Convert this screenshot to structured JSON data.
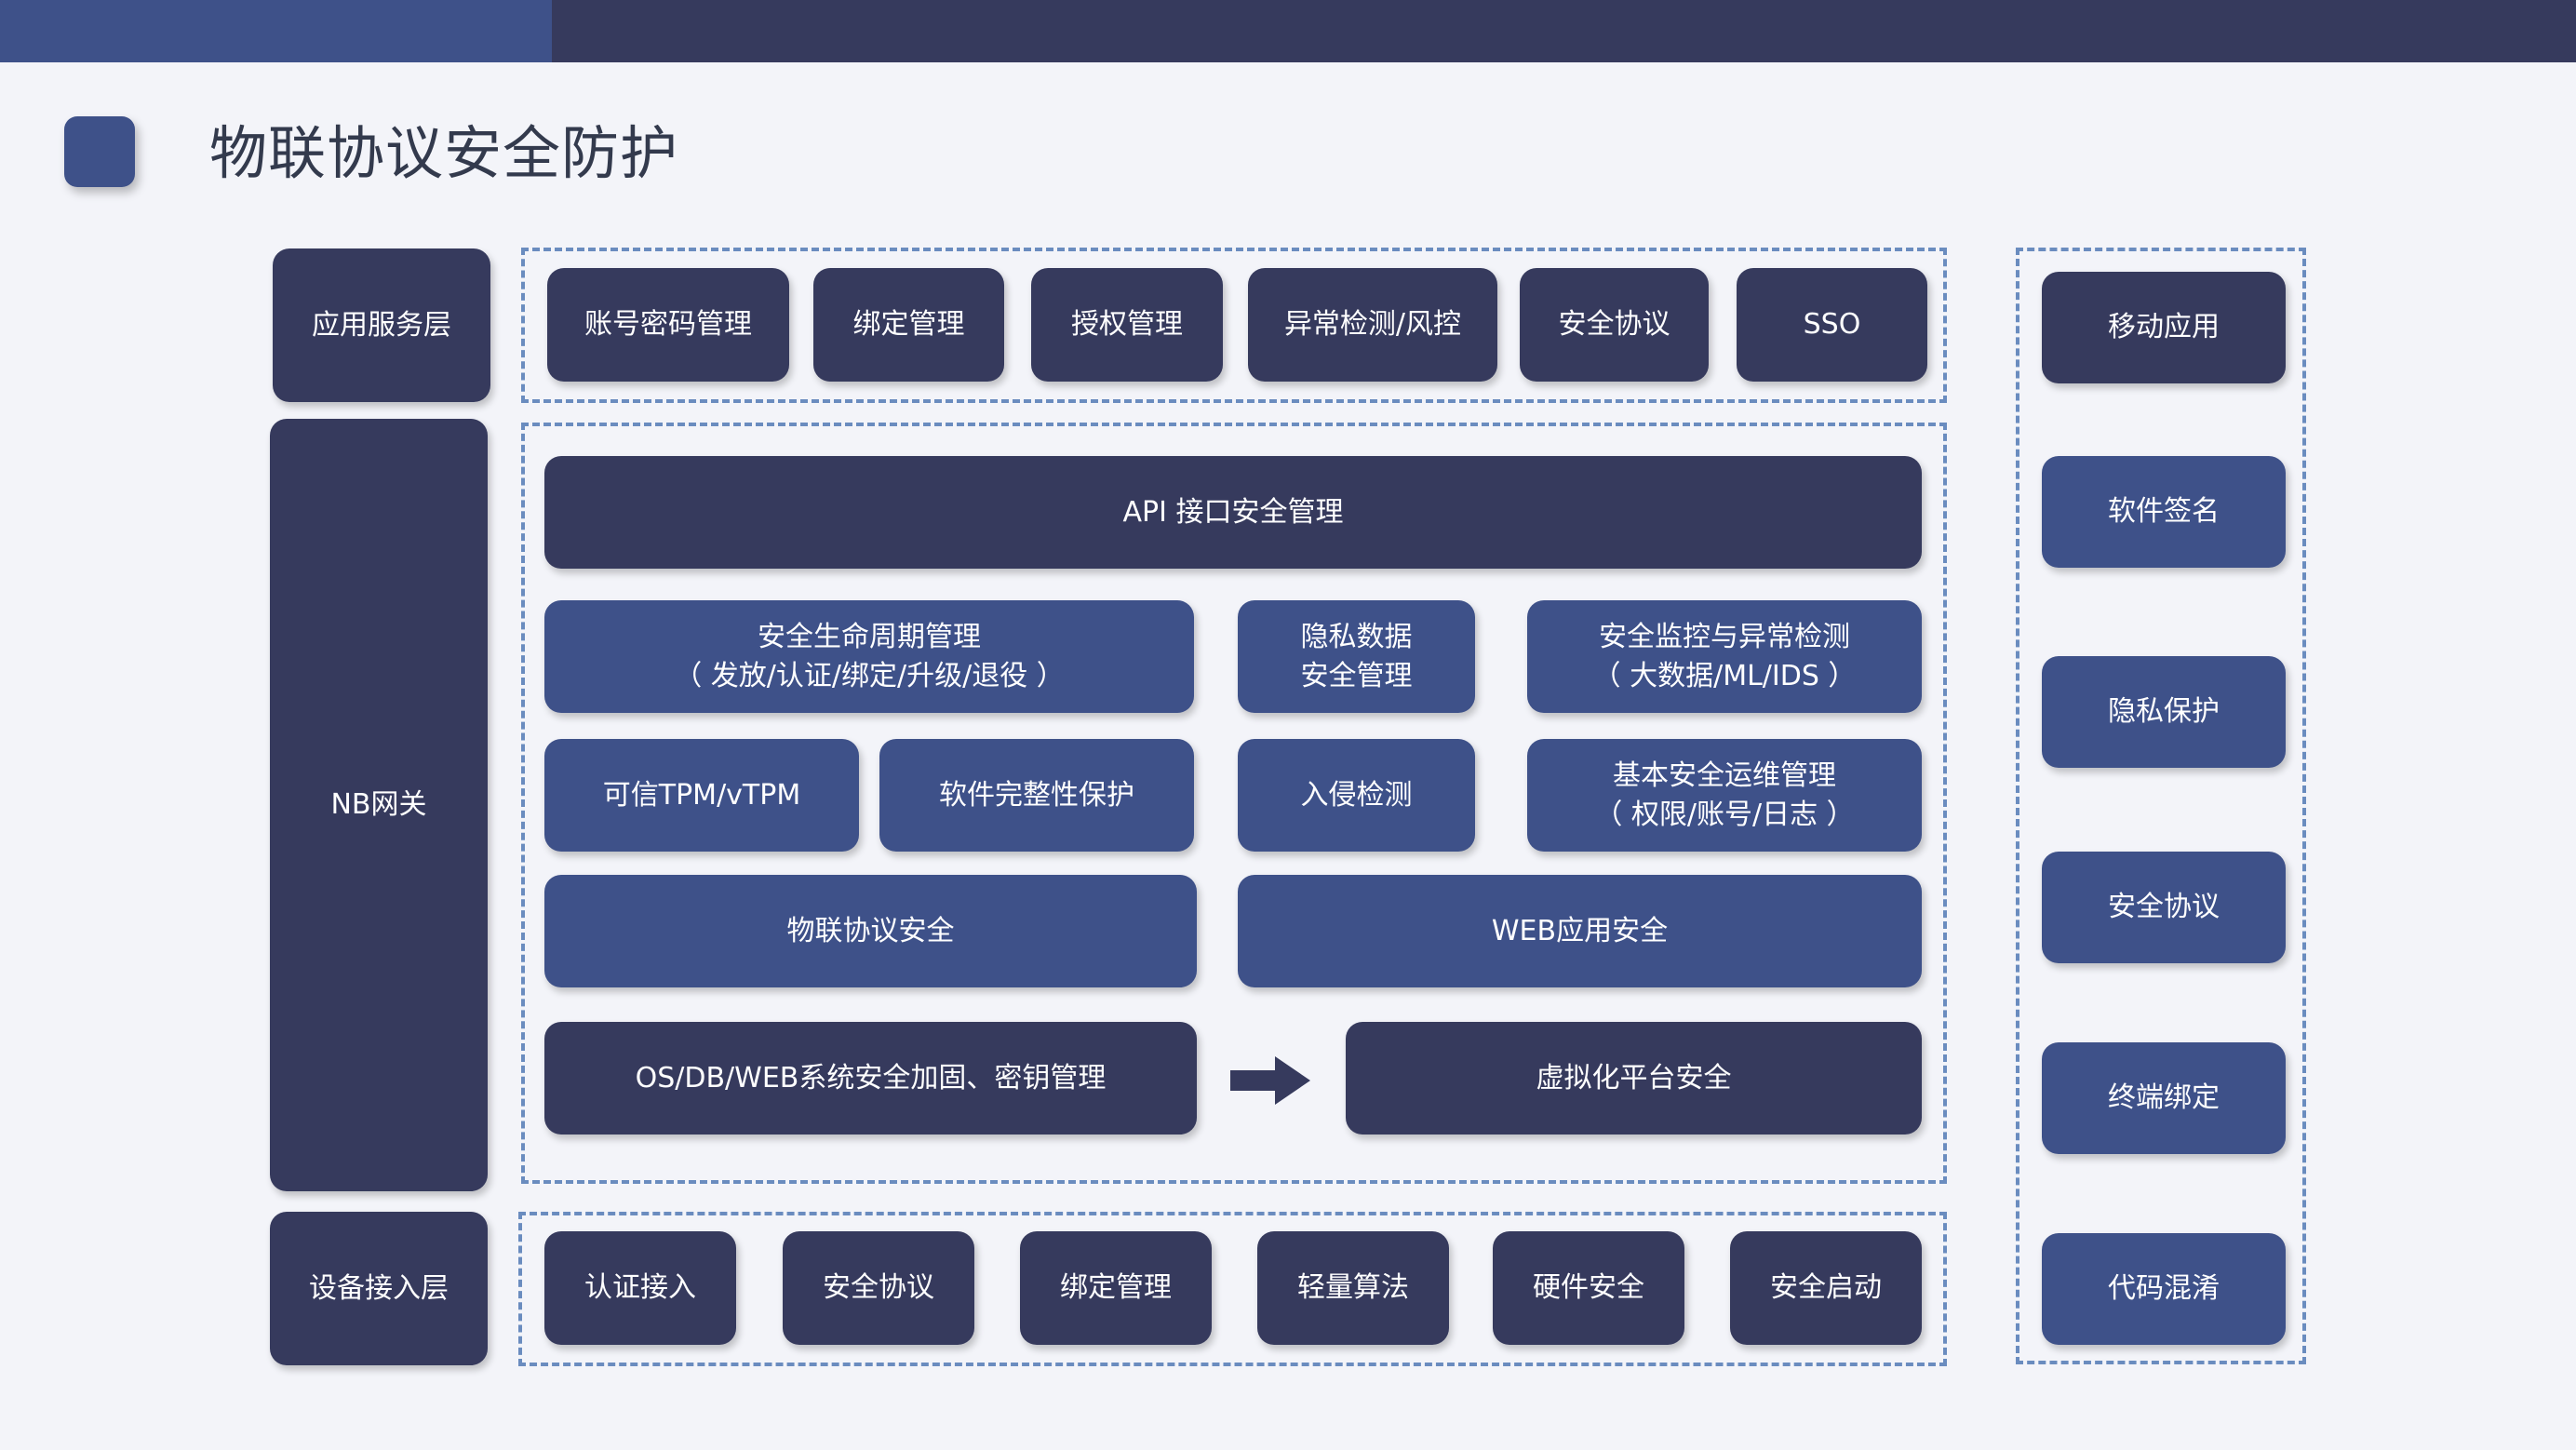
{
  "title": "物联协议安全防护",
  "layers": {
    "app": "应用服务层",
    "gateway": "NB网关",
    "device": "设备接入层"
  },
  "app_items": [
    "账号密码管理",
    "绑定管理",
    "授权管理",
    "异常检测/风控",
    "安全协议",
    "SSO"
  ],
  "middle": {
    "api": "API 接口安全管理",
    "lifecycle": {
      "line1": "安全生命周期管理",
      "line2": "（ 发放/认证/绑定/升级/退役 ）"
    },
    "privacy": {
      "line1": "隐私数据",
      "line2": "安全管理"
    },
    "monitor": {
      "line1": "安全监控与异常检测",
      "line2": "（ 大数据/ML/IDS ）"
    },
    "tpm": "可信TPM/vTPM",
    "integrity": "软件完整性保护",
    "intrusion": "入侵检测",
    "ops": {
      "line1": "基本安全运维管理",
      "line2": "（ 权限/账号/日志 ）"
    },
    "iot_protocol": "物联协议安全",
    "web_app": "WEB应用安全",
    "os_db": "OS/DB/WEB系统安全加固、密钥管理",
    "virtualization": "虚拟化平台安全"
  },
  "device_items": [
    "认证接入",
    "安全协议",
    "绑定管理",
    "轻量算法",
    "硬件安全",
    "安全启动"
  ],
  "right_items": [
    "移动应用",
    "软件签名",
    "隐私保护",
    "安全协议",
    "终端绑定",
    "代码混淆"
  ],
  "icons": {
    "flow_arrow": "arrow-right-icon"
  },
  "colors": {
    "dark": "#363a5d",
    "blue": "#3e5189",
    "dash": "#6a8cbf",
    "background": "#f3f4f9"
  }
}
